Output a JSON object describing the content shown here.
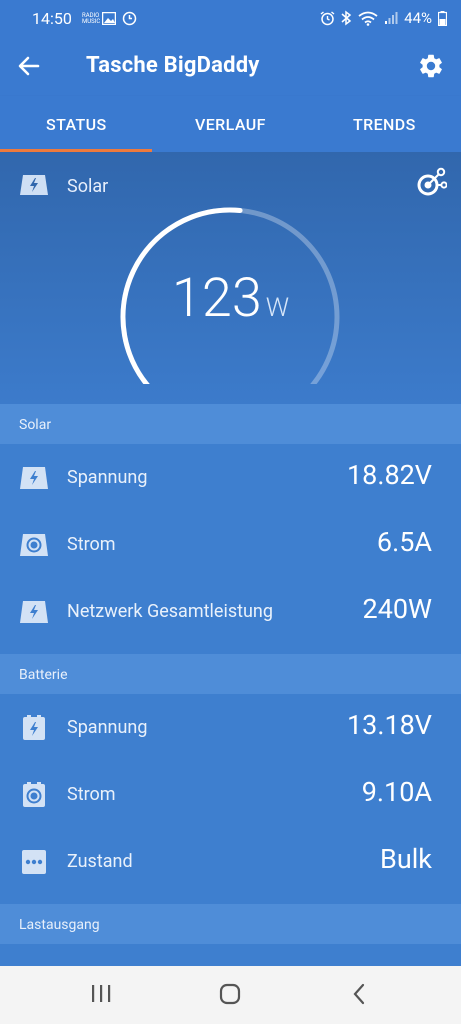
{
  "status_bar": {
    "time": "14:50",
    "tiny_text": "RADIO\nMUSIC",
    "battery": "44%"
  },
  "app_bar": {
    "title": "Tasche BigDaddy"
  },
  "tabs": [
    {
      "label": "STATUS",
      "active": true
    },
    {
      "label": "VERLAUF",
      "active": false
    },
    {
      "label": "TRENDS",
      "active": false
    }
  ],
  "hero": {
    "label": "Solar",
    "value": "123",
    "unit": "W",
    "gauge_fraction": 0.52
  },
  "sections": [
    {
      "title": "Solar",
      "rows": [
        {
          "label": "Spannung",
          "value": "18.82V",
          "icon": "bolt-icon"
        },
        {
          "label": "Strom",
          "value": "6.5A",
          "icon": "current-icon"
        },
        {
          "label": "Netzwerk Gesamtleistung",
          "value": "240W",
          "icon": "bolt-icon"
        }
      ]
    },
    {
      "title": "Batterie",
      "rows": [
        {
          "label": "Spannung",
          "value": "13.18V",
          "icon": "battery-bolt-icon"
        },
        {
          "label": "Strom",
          "value": "9.10A",
          "icon": "battery-current-icon"
        },
        {
          "label": "Zustand",
          "value": "Bulk",
          "icon": "dots-icon"
        }
      ]
    },
    {
      "title": "Lastausgang",
      "rows": []
    }
  ],
  "colors": {
    "primary": "#3a7ad0",
    "accent": "#ee7a3c",
    "list_bg": "#3e7fcf",
    "section_bg": "#4f8dd8"
  }
}
